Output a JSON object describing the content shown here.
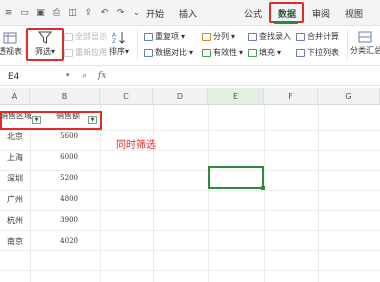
{
  "tabs": {
    "home": "开始",
    "insert": "插入",
    "formula": "公式",
    "data": "数据",
    "review": "审阅",
    "view": "视图"
  },
  "ribbon": {
    "pivot_table": "透视表",
    "filter": "筛选",
    "filter_arrow": "▾",
    "show_all": "全部显示",
    "reapply": "重新应用",
    "sort": "排序",
    "duplicates": "重复项",
    "compare": "数据对比",
    "split_column": "分列",
    "validity": "有效性",
    "lookup_entry": "查找录入",
    "fill": "填充",
    "consolidate": "合并计算",
    "dropdown_list": "下拉列表",
    "subtotal": "分类汇总"
  },
  "formula_bar": {
    "name_box": "E4",
    "zoom_icon": "⌕",
    "fx": "fx"
  },
  "grid": {
    "columns": [
      "A",
      "B",
      "C",
      "D",
      "E",
      "F",
      "G"
    ],
    "header_a": "销售区域",
    "header_b": "销售额",
    "rows": [
      {
        "region": "北京",
        "sales": "5600"
      },
      {
        "region": "上海",
        "sales": "6000"
      },
      {
        "region": "深圳",
        "sales": "5200"
      },
      {
        "region": "广州",
        "sales": "4800"
      },
      {
        "region": "杭州",
        "sales": "3900"
      },
      {
        "region": "南京",
        "sales": "4020"
      }
    ],
    "annotation": "同时筛选"
  },
  "colors": {
    "accent_green": "#2e8b3a",
    "highlight_red": "#e02b2b"
  }
}
